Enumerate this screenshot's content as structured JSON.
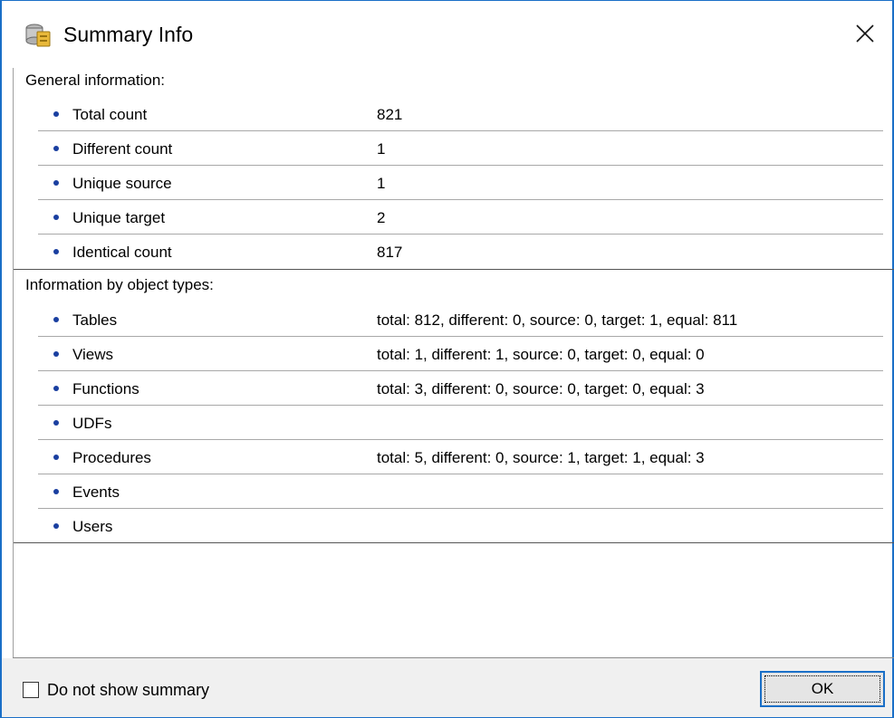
{
  "window": {
    "title": "Summary Info",
    "icon": "database-summary-icon",
    "close_icon": "close-icon"
  },
  "general": {
    "header": "General information:",
    "rows": [
      {
        "label": "Total count",
        "value": "821"
      },
      {
        "label": "Different count",
        "value": "1"
      },
      {
        "label": "Unique source",
        "value": "1"
      },
      {
        "label": "Unique target",
        "value": "2"
      },
      {
        "label": "Identical count",
        "value": "817"
      }
    ]
  },
  "by_type": {
    "header": "Information by object types:",
    "rows": [
      {
        "label": "Tables",
        "value": "total: 812, different: 0, source: 0, target: 1, equal: 811"
      },
      {
        "label": "Views",
        "value": "total: 1, different: 1, source: 0, target: 0, equal: 0"
      },
      {
        "label": "Functions",
        "value": "total: 3, different: 0, source: 0, target: 0, equal: 3"
      },
      {
        "label": "UDFs",
        "value": ""
      },
      {
        "label": "Procedures",
        "value": "total: 5, different: 0, source: 1, target: 1, equal: 3"
      },
      {
        "label": "Events",
        "value": ""
      },
      {
        "label": "Users",
        "value": ""
      }
    ]
  },
  "footer": {
    "checkbox_label": "Do not show summary",
    "checkbox_checked": false,
    "ok_label": "OK"
  },
  "colors": {
    "window_border": "#1a6fc7",
    "bullet": "#1a3fa0",
    "footer_bg": "#f0f0f0"
  }
}
